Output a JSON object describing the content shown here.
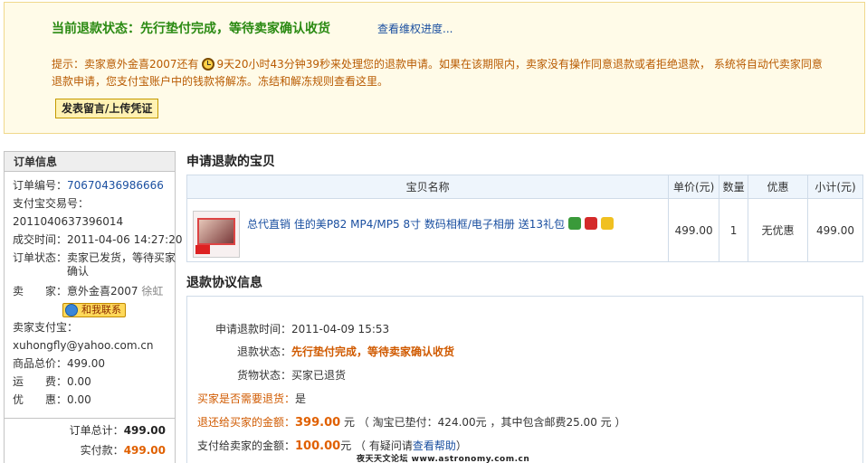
{
  "status": {
    "title": "当前退款状态：先行垫付完成，等待卖家确认收货",
    "progress_link": "查看维权进度...",
    "hint_pre": "提示：卖家意外金喜2007还有",
    "countdown": "9天20小时43分钟39秒",
    "hint_post": "来处理您的退款申请。如果在该期限内，卖家没有操作同意退款或者拒绝退款，  系统将自动代卖家同意退款申请，您支付宝账户中的钱款将解冻。冻结和解冻规则查看这里。",
    "upload_button": "发表留言/上传凭证",
    "icon": "clock-icon"
  },
  "order": {
    "heading": "订单信息",
    "order_no_label": "订单编号：",
    "order_no": "70670436986666",
    "alipay_no_label": "支付宝交易号：",
    "alipay_no": "2011040637396014",
    "deal_time_label": "成交时间：",
    "deal_time": "2011-04-06 14:27:20",
    "order_status_label": "订单状态：",
    "order_status_1": "卖家已发货，等待买家",
    "order_status_2": "确认",
    "seller_label": "卖　　家：",
    "seller": "意外金喜2007",
    "seller_alias": "徐虹",
    "contact_button": "和我联系",
    "seller_alipay_label": "卖家支付宝：",
    "seller_alipay": "xuhongfly@yahoo.com.cn",
    "goods_total_label": "商品总价：",
    "goods_total": "499.00",
    "shipping_label": "运　　费：",
    "shipping": "0.00",
    "discount_label": "优　　惠：",
    "discount": "0.00",
    "order_total_label": "订单总计：",
    "order_total": "499.00",
    "paid_label": "实付款：",
    "paid": "499.00"
  },
  "items": {
    "section_title": "申请退款的宝贝",
    "columns": [
      "宝贝名称",
      "单价(元)",
      "数量",
      "优惠",
      "小计(元)"
    ],
    "rows": [
      {
        "name": "总代直销 佳的美P82 MP4/MP5 8寸 数码相框/电子相册 送13礼包",
        "price": "499.00",
        "qty": "1",
        "discount": "无优惠",
        "subtotal": "499.00"
      }
    ]
  },
  "refund": {
    "section_title": "退款协议信息",
    "apply_time_label": "申请退款时间：",
    "apply_time": "2011-04-09 15:53",
    "refund_status_label": "退款状态：",
    "refund_status": "先行垫付完成，等待卖家确认收货",
    "goods_status_label": "货物状态：",
    "goods_status": "买家已退货",
    "need_return_label": "买家是否需要退货：",
    "need_return": "是",
    "refund_amount_label": "退还给买家的金额：",
    "refund_amount": "399.00",
    "refund_amount_unit": "元",
    "refund_amount_note": "（ 淘宝已垫付：424.00元  ，其中包含邮费25.00 元  ）",
    "pay_seller_label": "支付给卖家的金额：",
    "pay_seller": "100.00",
    "pay_seller_unit": "元",
    "pay_seller_note_pre": "（ 有疑问请",
    "pay_seller_help": "查看帮助",
    "pay_seller_note_post": "）"
  },
  "watermark": "夜天天文论坛 www.astronomy.com.cn"
}
